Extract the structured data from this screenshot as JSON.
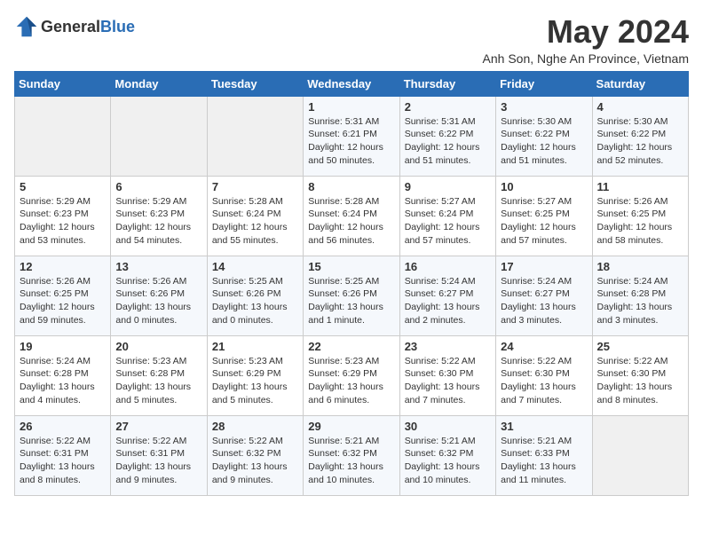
{
  "header": {
    "logo_general": "General",
    "logo_blue": "Blue",
    "month_title": "May 2024",
    "location": "Anh Son, Nghe An Province, Vietnam"
  },
  "weekdays": [
    "Sunday",
    "Monday",
    "Tuesday",
    "Wednesday",
    "Thursday",
    "Friday",
    "Saturday"
  ],
  "weeks": [
    [
      {
        "day": "",
        "text": ""
      },
      {
        "day": "",
        "text": ""
      },
      {
        "day": "",
        "text": ""
      },
      {
        "day": "1",
        "text": "Sunrise: 5:31 AM\nSunset: 6:21 PM\nDaylight: 12 hours\nand 50 minutes."
      },
      {
        "day": "2",
        "text": "Sunrise: 5:31 AM\nSunset: 6:22 PM\nDaylight: 12 hours\nand 51 minutes."
      },
      {
        "day": "3",
        "text": "Sunrise: 5:30 AM\nSunset: 6:22 PM\nDaylight: 12 hours\nand 51 minutes."
      },
      {
        "day": "4",
        "text": "Sunrise: 5:30 AM\nSunset: 6:22 PM\nDaylight: 12 hours\nand 52 minutes."
      }
    ],
    [
      {
        "day": "5",
        "text": "Sunrise: 5:29 AM\nSunset: 6:23 PM\nDaylight: 12 hours\nand 53 minutes."
      },
      {
        "day": "6",
        "text": "Sunrise: 5:29 AM\nSunset: 6:23 PM\nDaylight: 12 hours\nand 54 minutes."
      },
      {
        "day": "7",
        "text": "Sunrise: 5:28 AM\nSunset: 6:24 PM\nDaylight: 12 hours\nand 55 minutes."
      },
      {
        "day": "8",
        "text": "Sunrise: 5:28 AM\nSunset: 6:24 PM\nDaylight: 12 hours\nand 56 minutes."
      },
      {
        "day": "9",
        "text": "Sunrise: 5:27 AM\nSunset: 6:24 PM\nDaylight: 12 hours\nand 57 minutes."
      },
      {
        "day": "10",
        "text": "Sunrise: 5:27 AM\nSunset: 6:25 PM\nDaylight: 12 hours\nand 57 minutes."
      },
      {
        "day": "11",
        "text": "Sunrise: 5:26 AM\nSunset: 6:25 PM\nDaylight: 12 hours\nand 58 minutes."
      }
    ],
    [
      {
        "day": "12",
        "text": "Sunrise: 5:26 AM\nSunset: 6:25 PM\nDaylight: 12 hours\nand 59 minutes."
      },
      {
        "day": "13",
        "text": "Sunrise: 5:26 AM\nSunset: 6:26 PM\nDaylight: 13 hours\nand 0 minutes."
      },
      {
        "day": "14",
        "text": "Sunrise: 5:25 AM\nSunset: 6:26 PM\nDaylight: 13 hours\nand 0 minutes."
      },
      {
        "day": "15",
        "text": "Sunrise: 5:25 AM\nSunset: 6:26 PM\nDaylight: 13 hours\nand 1 minute."
      },
      {
        "day": "16",
        "text": "Sunrise: 5:24 AM\nSunset: 6:27 PM\nDaylight: 13 hours\nand 2 minutes."
      },
      {
        "day": "17",
        "text": "Sunrise: 5:24 AM\nSunset: 6:27 PM\nDaylight: 13 hours\nand 3 minutes."
      },
      {
        "day": "18",
        "text": "Sunrise: 5:24 AM\nSunset: 6:28 PM\nDaylight: 13 hours\nand 3 minutes."
      }
    ],
    [
      {
        "day": "19",
        "text": "Sunrise: 5:24 AM\nSunset: 6:28 PM\nDaylight: 13 hours\nand 4 minutes."
      },
      {
        "day": "20",
        "text": "Sunrise: 5:23 AM\nSunset: 6:28 PM\nDaylight: 13 hours\nand 5 minutes."
      },
      {
        "day": "21",
        "text": "Sunrise: 5:23 AM\nSunset: 6:29 PM\nDaylight: 13 hours\nand 5 minutes."
      },
      {
        "day": "22",
        "text": "Sunrise: 5:23 AM\nSunset: 6:29 PM\nDaylight: 13 hours\nand 6 minutes."
      },
      {
        "day": "23",
        "text": "Sunrise: 5:22 AM\nSunset: 6:30 PM\nDaylight: 13 hours\nand 7 minutes."
      },
      {
        "day": "24",
        "text": "Sunrise: 5:22 AM\nSunset: 6:30 PM\nDaylight: 13 hours\nand 7 minutes."
      },
      {
        "day": "25",
        "text": "Sunrise: 5:22 AM\nSunset: 6:30 PM\nDaylight: 13 hours\nand 8 minutes."
      }
    ],
    [
      {
        "day": "26",
        "text": "Sunrise: 5:22 AM\nSunset: 6:31 PM\nDaylight: 13 hours\nand 8 minutes."
      },
      {
        "day": "27",
        "text": "Sunrise: 5:22 AM\nSunset: 6:31 PM\nDaylight: 13 hours\nand 9 minutes."
      },
      {
        "day": "28",
        "text": "Sunrise: 5:22 AM\nSunset: 6:32 PM\nDaylight: 13 hours\nand 9 minutes."
      },
      {
        "day": "29",
        "text": "Sunrise: 5:21 AM\nSunset: 6:32 PM\nDaylight: 13 hours\nand 10 minutes."
      },
      {
        "day": "30",
        "text": "Sunrise: 5:21 AM\nSunset: 6:32 PM\nDaylight: 13 hours\nand 10 minutes."
      },
      {
        "day": "31",
        "text": "Sunrise: 5:21 AM\nSunset: 6:33 PM\nDaylight: 13 hours\nand 11 minutes."
      },
      {
        "day": "",
        "text": ""
      }
    ]
  ]
}
